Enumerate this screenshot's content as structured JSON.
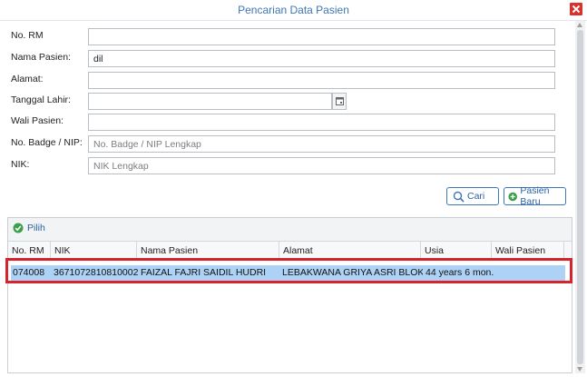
{
  "window": {
    "title": "Pencarian Data Pasien"
  },
  "form": {
    "fields": [
      {
        "label": "No. RM",
        "value": "",
        "placeholder": ""
      },
      {
        "label": "Nama Pasien:",
        "value": "dil",
        "placeholder": ""
      },
      {
        "label": "Alamat:",
        "value": "",
        "placeholder": ""
      },
      {
        "label": "Tanggal Lahir:",
        "value": "",
        "placeholder": ""
      },
      {
        "label": "Wali Pasien:",
        "value": "",
        "placeholder": ""
      },
      {
        "label": "No. Badge / NIP:",
        "value": "",
        "placeholder": "No. Badge / NIP Lengkap"
      },
      {
        "label": "NIK:",
        "value": "",
        "placeholder": "NIK Lengkap"
      }
    ],
    "cari_label": "Cari",
    "pasien_baru_label": "Pasien Baru"
  },
  "grid": {
    "pilih_label": "Pilih",
    "columns": [
      "No. RM",
      "NIK",
      "Nama Pasien",
      "Alamat",
      "Usia",
      "Wali Pasien"
    ],
    "rows": [
      {
        "no_rm": "074008",
        "nik": "3671072810810002",
        "nama": "FAIZAL FAJRI SAIDIL HUDRI",
        "alamat": "LEBAKWANA GRIYA ASRI BLOK U ...",
        "usia": "44 years 6 mon...",
        "wali": ""
      }
    ]
  },
  "colors": {
    "accent": "#3f76b5",
    "selected_row": "#aed2f6",
    "highlight": "#d8232a",
    "close": "#d9312b"
  },
  "icons": {
    "close": "close-icon",
    "calendar": "calendar-icon",
    "search": "search-icon",
    "add": "plus-circle-icon",
    "check": "check-circle-icon"
  }
}
